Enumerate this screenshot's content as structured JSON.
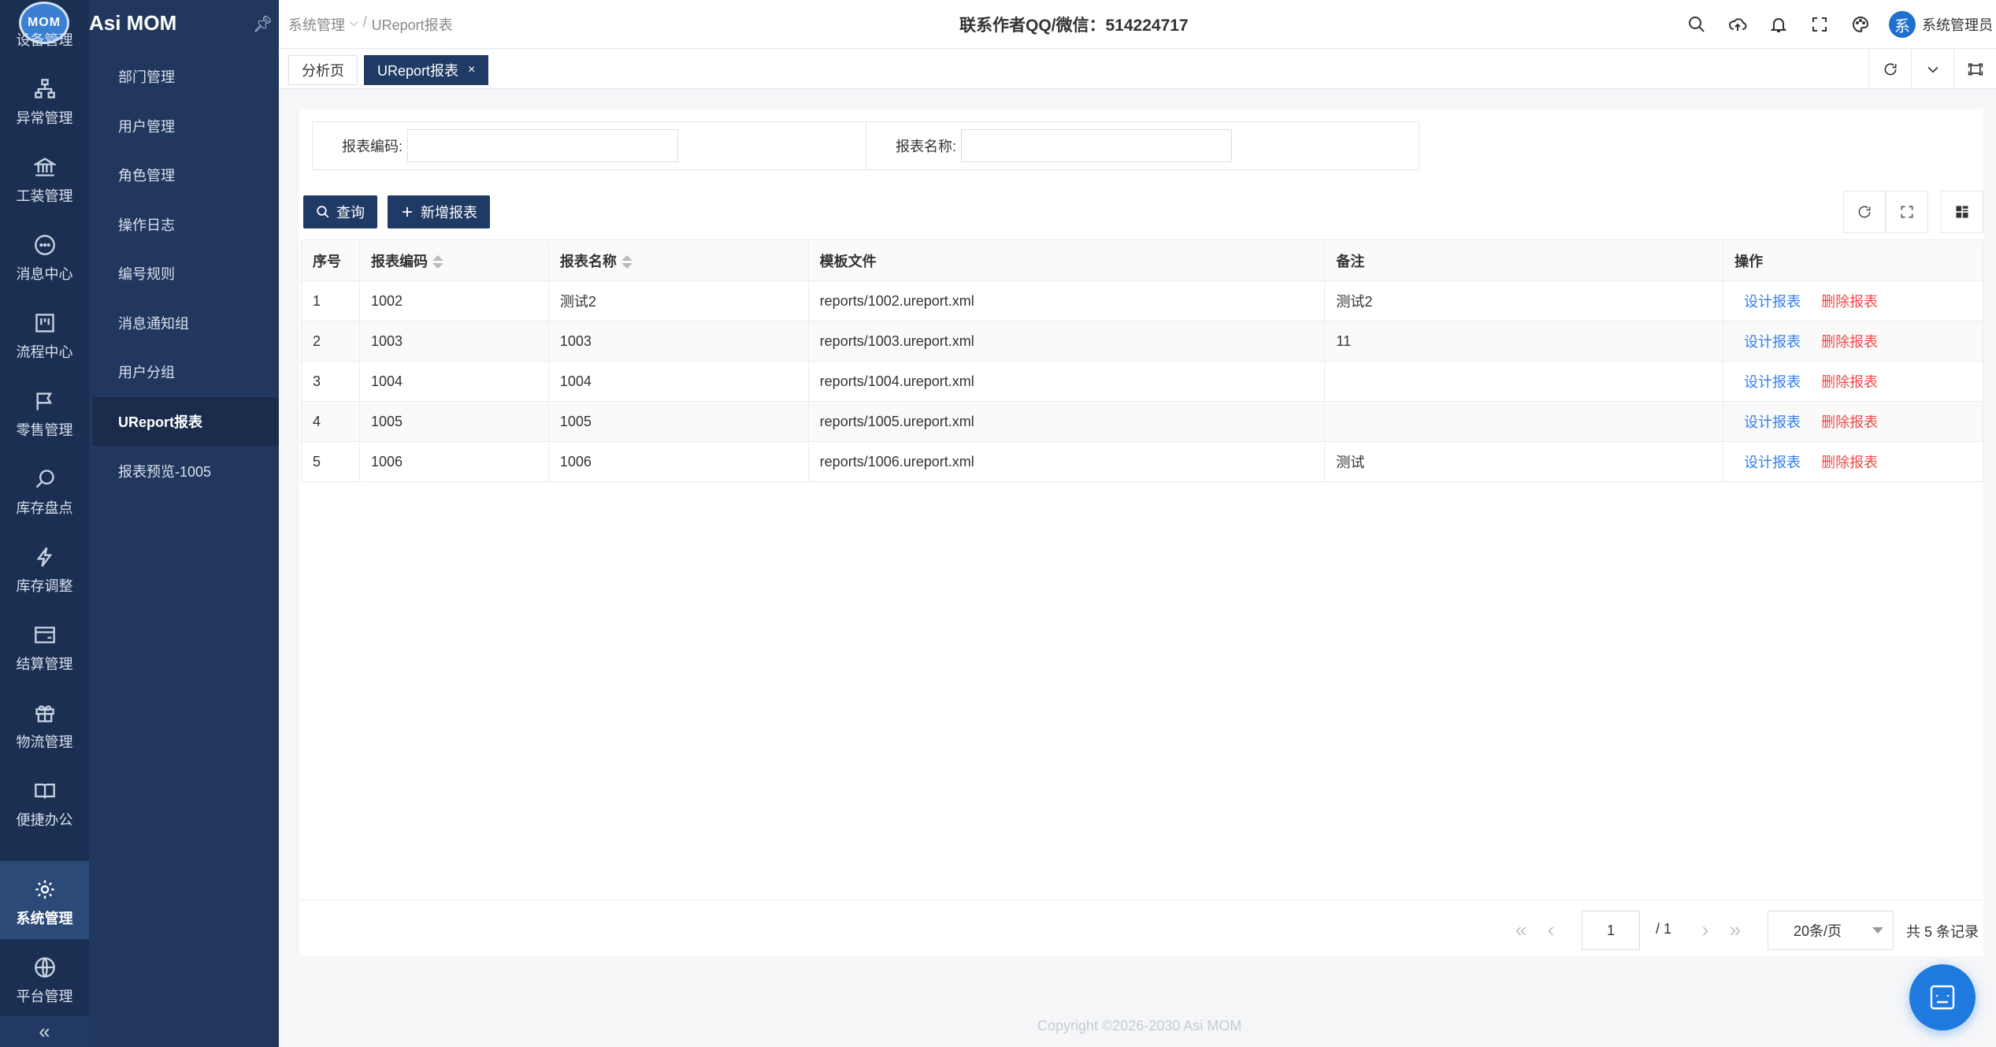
{
  "app": {
    "logo_text": "MOM",
    "title": "Asi MOM"
  },
  "rail": {
    "items": [
      {
        "label": "设备管理",
        "icon": "device-icon"
      },
      {
        "label": "异常管理",
        "icon": "sitemap-icon"
      },
      {
        "label": "工装管理",
        "icon": "bank-icon"
      },
      {
        "label": "消息中心",
        "icon": "message-icon"
      },
      {
        "label": "流程中心",
        "icon": "flow-icon"
      },
      {
        "label": "零售管理",
        "icon": "flag-icon"
      },
      {
        "label": "库存盘点",
        "icon": "search-circle-icon"
      },
      {
        "label": "库存调整",
        "icon": "thunder-icon"
      },
      {
        "label": "结算管理",
        "icon": "card-icon"
      },
      {
        "label": "物流管理",
        "icon": "gift-icon"
      },
      {
        "label": "便捷办公",
        "icon": "book-icon"
      },
      {
        "label": "系统管理",
        "icon": "gear-icon",
        "active": true
      },
      {
        "label": "平台管理",
        "icon": "globe-icon"
      }
    ],
    "collapse_glyph": "«"
  },
  "submenu": {
    "items": [
      {
        "label": "部门管理"
      },
      {
        "label": "用户管理"
      },
      {
        "label": "角色管理"
      },
      {
        "label": "操作日志"
      },
      {
        "label": "编号规则"
      },
      {
        "label": "消息通知组"
      },
      {
        "label": "用户分组"
      },
      {
        "label": "UReport报表",
        "active": true
      },
      {
        "label": "报表预览-1005"
      }
    ]
  },
  "header": {
    "breadcrumb": {
      "parent": "系统管理",
      "separator": "/",
      "current": "UReport报表"
    },
    "contact": "联系作者QQ/微信：514224717",
    "user": {
      "avatar_text": "系",
      "name": "系统管理员"
    }
  },
  "tabs": [
    {
      "label": "分析页"
    },
    {
      "label": "UReport报表",
      "active": true,
      "close": "×"
    }
  ],
  "search": {
    "code_label": "报表编码:",
    "code_value": "",
    "name_label": "报表名称:",
    "name_value": ""
  },
  "toolbar": {
    "query_label": "查询",
    "add_label": "新增报表"
  },
  "table": {
    "columns": [
      "序号",
      "报表编码",
      "报表名称",
      "模板文件",
      "备注",
      "操作"
    ],
    "rows": [
      {
        "index": "1",
        "code": "1002",
        "name": "测试2",
        "file": "reports/1002.ureport.xml",
        "remark": "测试2"
      },
      {
        "index": "2",
        "code": "1003",
        "name": "1003",
        "file": "reports/1003.ureport.xml",
        "remark": "11"
      },
      {
        "index": "3",
        "code": "1004",
        "name": "1004",
        "file": "reports/1004.ureport.xml",
        "remark": ""
      },
      {
        "index": "4",
        "code": "1005",
        "name": "1005",
        "file": "reports/1005.ureport.xml",
        "remark": ""
      },
      {
        "index": "5",
        "code": "1006",
        "name": "1006",
        "file": "reports/1006.ureport.xml",
        "remark": "测试"
      }
    ],
    "action_design": "设计报表",
    "action_delete": "删除报表"
  },
  "pager": {
    "current_page": "1",
    "total_pages": "/ 1",
    "page_size": "20条/页",
    "total_records": "共 5 条记录"
  },
  "footer": {
    "copyright": "Copyright ©2026-2030 Asi MOM"
  },
  "colors": {
    "primary": "#1f3a64",
    "link": "#2f7ff0",
    "danger": "#f04848",
    "rail_bg": "#1b2f52"
  }
}
